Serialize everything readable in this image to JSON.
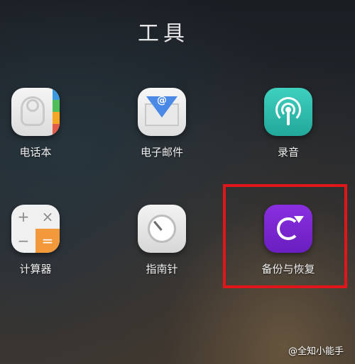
{
  "folder": {
    "title": "工具"
  },
  "apps": [
    {
      "label": "电话本"
    },
    {
      "label": "电子邮件"
    },
    {
      "label": "录音"
    },
    {
      "label": "计算器"
    },
    {
      "label": "指南针"
    },
    {
      "label": "备份与恢复"
    }
  ],
  "calculator_symbols": {
    "plus": "+",
    "times": "×",
    "minus": "−",
    "equals": "="
  },
  "email_symbol": "@",
  "watermark": "@全知小能手",
  "colors": {
    "phonebook_tabs": [
      "#3a9be3",
      "#4fbf5a",
      "#f5a623",
      "#e35a4a"
    ],
    "email_accent": "#4b89e6",
    "recorder": "#2bbcac",
    "calculator_equals": "#f29a3b",
    "backup": "#7b27d6",
    "highlight": "#e0161b"
  }
}
